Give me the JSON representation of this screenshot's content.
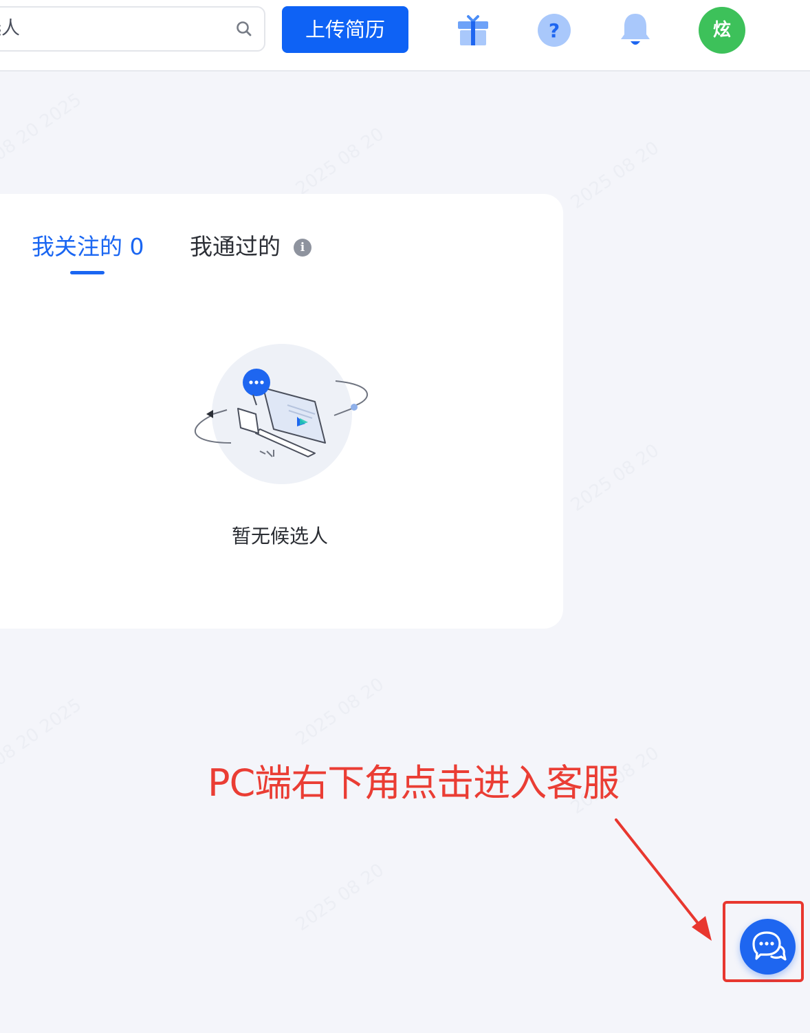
{
  "header": {
    "search": {
      "value": "候选人",
      "icon": "search-icon"
    },
    "upload_label": "上传简历",
    "icons": {
      "gift": "gift-icon",
      "help": "question-icon",
      "notify": "bell-icon"
    },
    "avatar_text": "炫",
    "avatar_color": "#3dc15a",
    "accent_color": "#0e62f5"
  },
  "tabs": [
    {
      "label": "我关注的 0",
      "active": true
    },
    {
      "label": "我通过的",
      "active": false,
      "icon": "info-icon",
      "icon_text": "i"
    }
  ],
  "empty_state": {
    "text": "暂无候选人",
    "illustration": "empty-candidates-illustration"
  },
  "annotation": {
    "text": "PC端右下角点击进入客服",
    "color": "#ea3d34"
  },
  "chat_button": {
    "icon": "chat-bubbles-icon",
    "color": "#1e66f0"
  }
}
